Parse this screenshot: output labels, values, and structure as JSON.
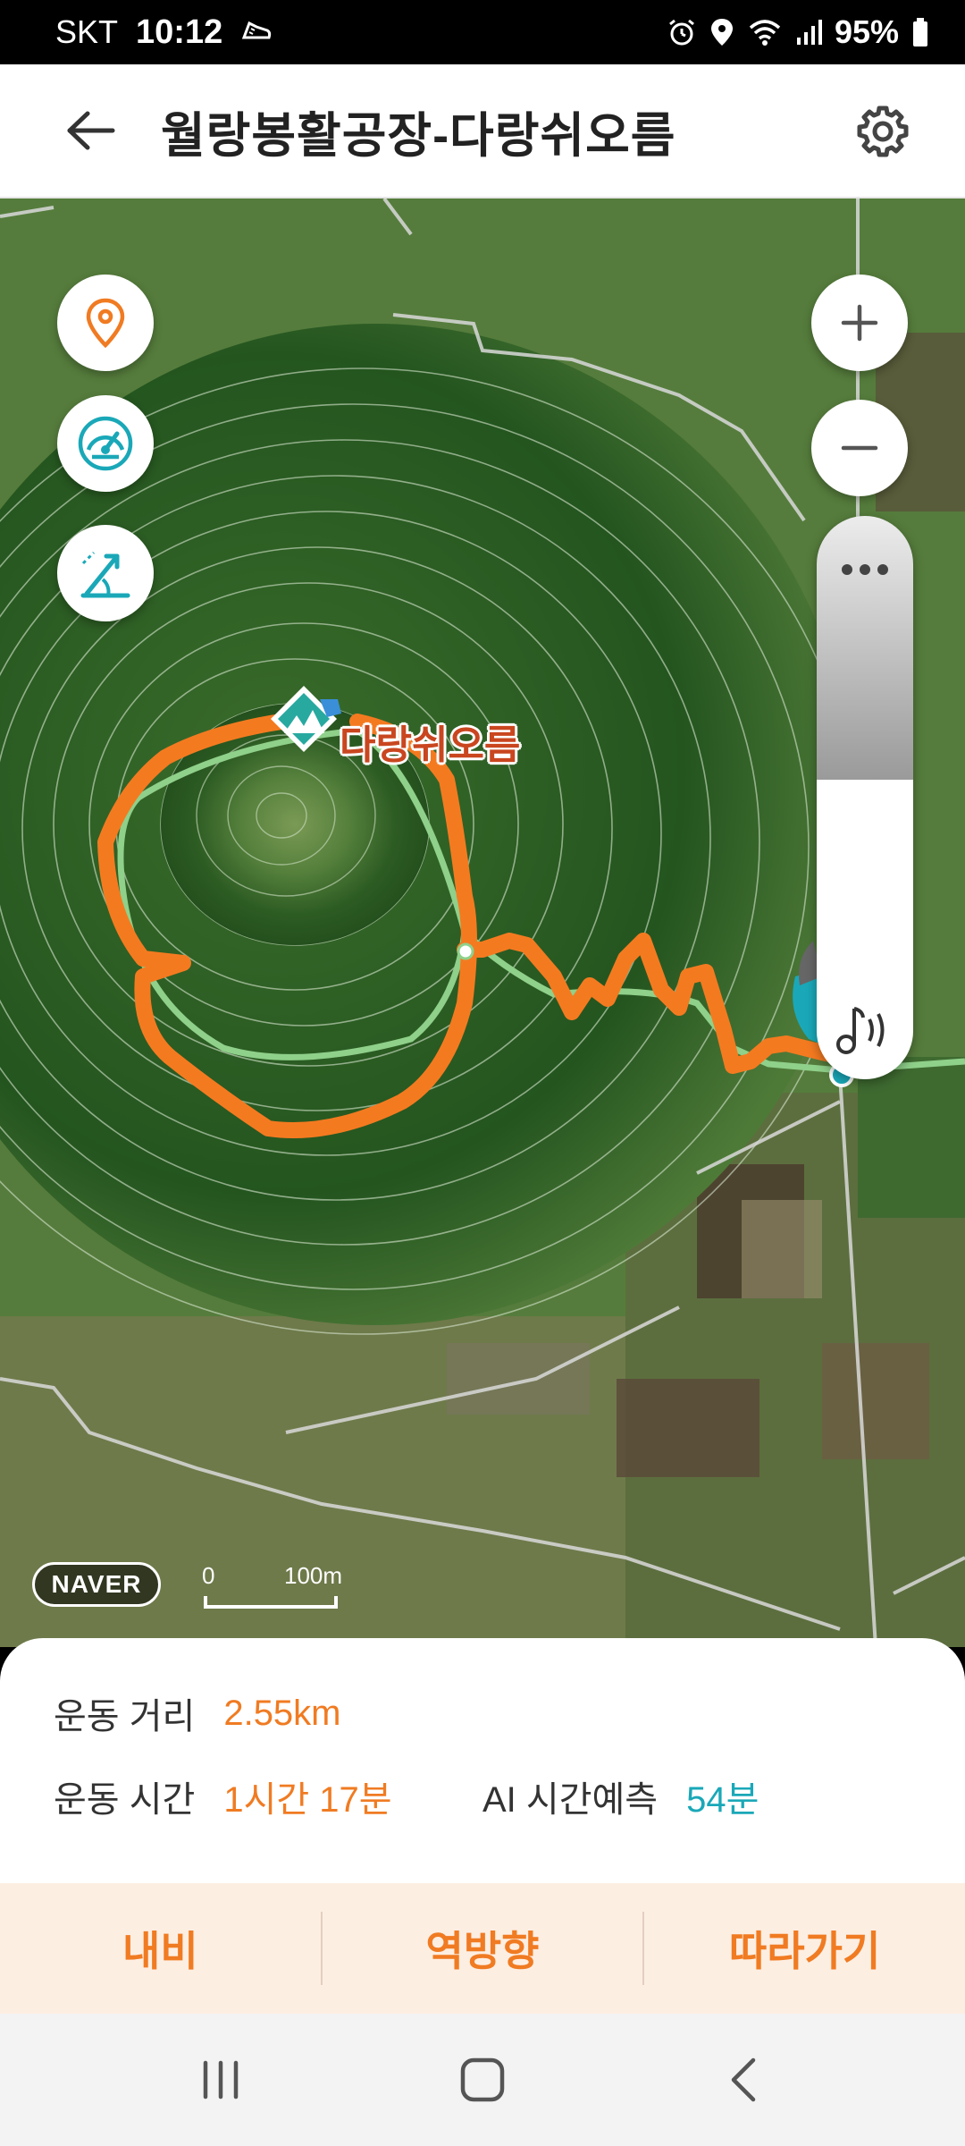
{
  "status_bar": {
    "carrier": "SKT",
    "time": "10:12",
    "battery": "95%"
  },
  "header": {
    "title": "월랑봉활공장-다랑쉬오름"
  },
  "map": {
    "peak_label": "다랑쉬오름",
    "provider_logo": "NAVER",
    "scale_zero": "0",
    "scale_label": "100m",
    "track_color": "#f47a20",
    "trail_color": "#8fd08a"
  },
  "stats": {
    "distance_label": "운동 거리",
    "distance_value": "2.55km",
    "time_label": "운동 시간",
    "time_value": "1시간 17분",
    "ai_label": "AI 시간예측",
    "ai_value": "54분"
  },
  "actions": {
    "navi": "내비",
    "reverse": "역방향",
    "follow": "따라가기"
  },
  "colors": {
    "accent": "#f07b22",
    "teal": "#1aa8b8"
  }
}
